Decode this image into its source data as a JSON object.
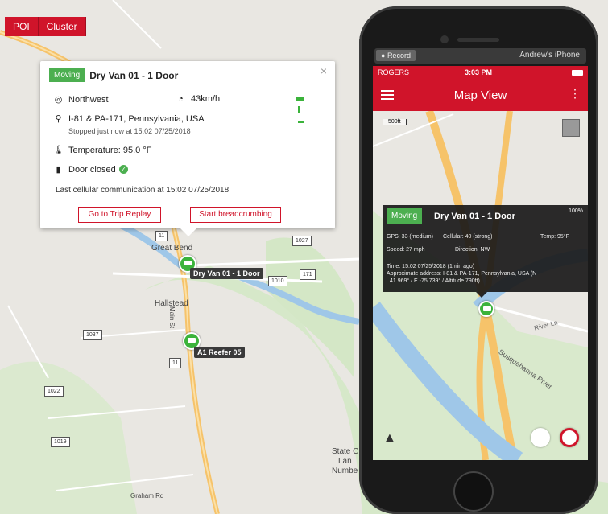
{
  "toolbar": {
    "poi": "POI",
    "cluster": "Cluster"
  },
  "map": {
    "places": {
      "great_bend": "Great Bend",
      "hallstead": "Hallstead",
      "main_st": "Main St",
      "state_land": "State C",
      "land2": "Lan",
      "numbe": "Numbe",
      "graham": "Graham Rd"
    },
    "shields": {
      "s11a": "11",
      "s11b": "11",
      "s1037": "1037",
      "s1022": "1022",
      "s1027": "1027",
      "s1010": "1010",
      "s171": "171",
      "s1019": "1019"
    },
    "vehicles": [
      "Dry Van 01 - 1 Door",
      "A1 Reefer 05"
    ]
  },
  "popup": {
    "status": "Moving",
    "title": "Dry Van 01 - 1 Door",
    "direction": "Northwest",
    "speed": "43km/h",
    "address": "I-81 & PA-171, Pennsylvania, USA",
    "stopped": "Stopped just now at 15:02 07/25/2018",
    "temperature": "Temperature: 95.0 °F",
    "door": "Door closed",
    "last_comm": "Last cellular communication at 15:02 07/25/2018",
    "btn_replay": "Go to Trip Replay",
    "btn_bread": "Start breadcrumbing",
    "close": "×"
  },
  "phone": {
    "record": "Record",
    "device": "Andrew's iPhone",
    "carrier": "ROGERS",
    "time": "3:03 PM",
    "title": "Map View",
    "scale": "500ft",
    "popup": {
      "status": "Moving",
      "title": "Dry Van 01 - 1 Door",
      "battery": "100%",
      "gps": "GPS: 33 (medium)",
      "cell": "Cellular: 40 (strong)",
      "temp": "Temp: 95°F",
      "speed": "Speed: 27 mph",
      "direction": "Direction: NW",
      "time": "Time: 15:02 07/25/2018 (1min ago)",
      "addr1": "Approximate address: I-81 & PA-171, Pennsylvania, USA (N",
      "addr2": "41.969° / E -75.739° / Altitude 790ft)"
    },
    "map_labels": {
      "river": "Susquehanna River",
      "river_ln": "River Ln"
    }
  },
  "colors": {
    "brand_red": "#d0142a",
    "moving_green": "#4caf50"
  }
}
